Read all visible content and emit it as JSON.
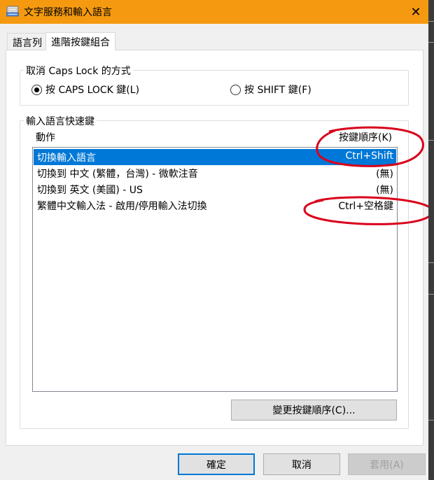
{
  "window": {
    "title": "文字服務和輸入語言",
    "close_symbol": "✕",
    "titlebar_color": "#f59a10"
  },
  "tabs": [
    {
      "label": "語言列",
      "active": false
    },
    {
      "label": "進階按鍵組合",
      "active": true
    }
  ],
  "caps_lock_group": {
    "label": "取消 Caps Lock 的方式",
    "options": [
      {
        "label": "按 CAPS LOCK 鍵(L)",
        "checked": true
      },
      {
        "label": "按 SHIFT 鍵(F)",
        "checked": false
      }
    ]
  },
  "hotkeys_group": {
    "label": "輸入語言快速鍵",
    "columns": {
      "action": "動作",
      "key_sequence": "按鍵順序(K)"
    },
    "rows": [
      {
        "action": "切換輸入語言",
        "keys": "Ctrl+Shift",
        "selected": true
      },
      {
        "action": "切換到 中文 (繁體，台灣) - 微軟注音",
        "keys": "(無)",
        "selected": false
      },
      {
        "action": "切換到 英文 (美國) - US",
        "keys": "(無)",
        "selected": false
      },
      {
        "action": "繁體中文輸入法 - 啟用/停用輸入法切換",
        "keys": "Ctrl+空格鍵",
        "selected": false
      }
    ],
    "change_sequence_button": "變更按鍵順序(C)..."
  },
  "footer": {
    "ok": "確定",
    "cancel": "取消",
    "apply": "套用(A)"
  },
  "annotations": {
    "ellipse_color": "#d9001b"
  },
  "icons": {
    "title": "keyboard-icon",
    "close": "close-icon"
  }
}
